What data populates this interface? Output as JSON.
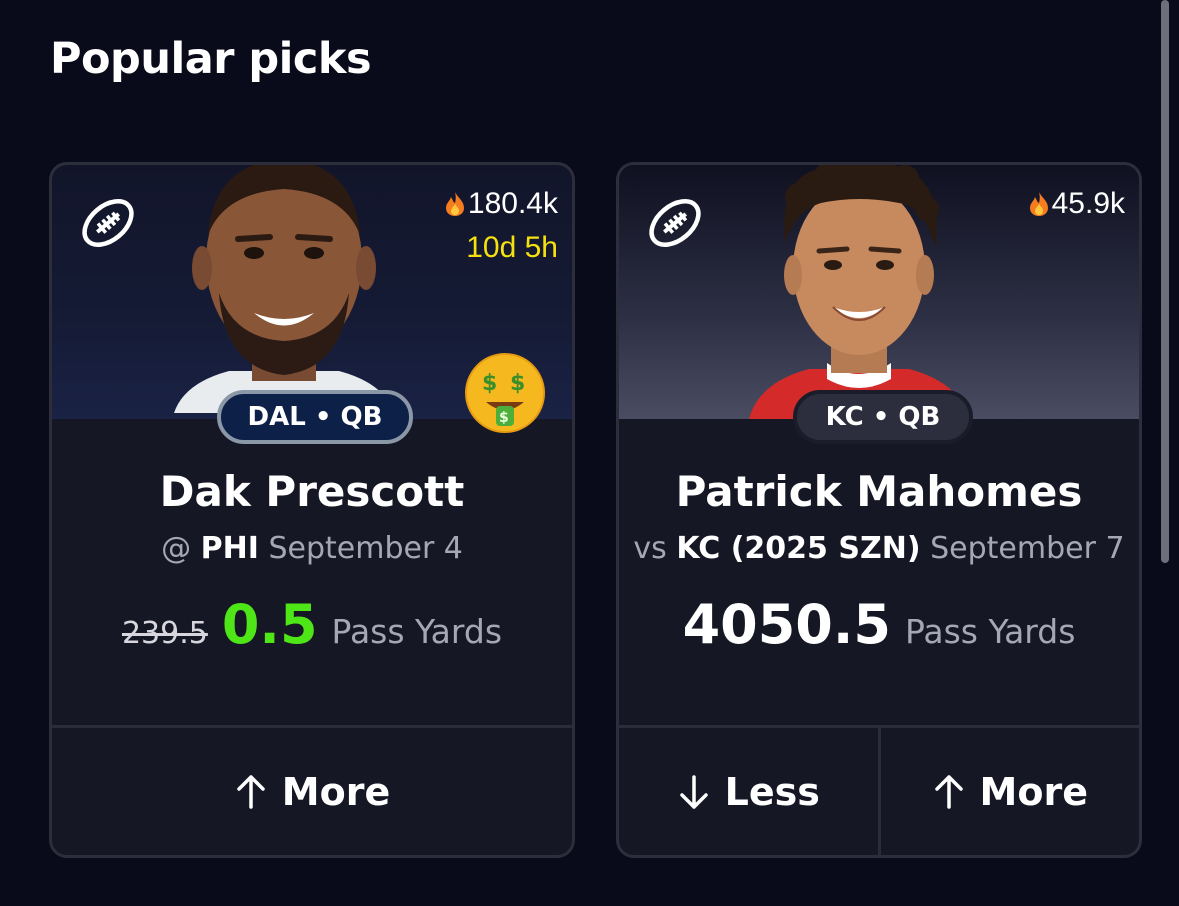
{
  "page": {
    "title": "Popular picks"
  },
  "cards": [
    {
      "team_position": "DAL • QB",
      "popularity": "180.4k",
      "timer": "10d 5h",
      "player_name": "Dak Prescott",
      "matchup_prefix": "@",
      "opponent": "PHI",
      "date": "September 4",
      "original_line": "239.5",
      "line": "0.5",
      "stat": "Pass Yards",
      "badge_icon": "money-mouth-face-icon",
      "actions": [
        {
          "label": "More",
          "icon": "arrow-up-icon"
        }
      ]
    },
    {
      "team_position": "KC • QB",
      "popularity": "45.9k",
      "player_name": "Patrick Mahomes",
      "matchup_prefix": "vs",
      "opponent": "KC (2025 SZN)",
      "date": "September 7",
      "line": "4050.5",
      "stat": "Pass Yards",
      "actions": [
        {
          "label": "Less",
          "icon": "arrow-down-icon"
        },
        {
          "label": "More",
          "icon": "arrow-up-icon"
        }
      ]
    }
  ],
  "colors": {
    "background": "#0a0b1a",
    "card": "#161724",
    "discount_line": "#4ee617",
    "timer": "#f5e10e",
    "muted_text": "#a6a7b4"
  }
}
